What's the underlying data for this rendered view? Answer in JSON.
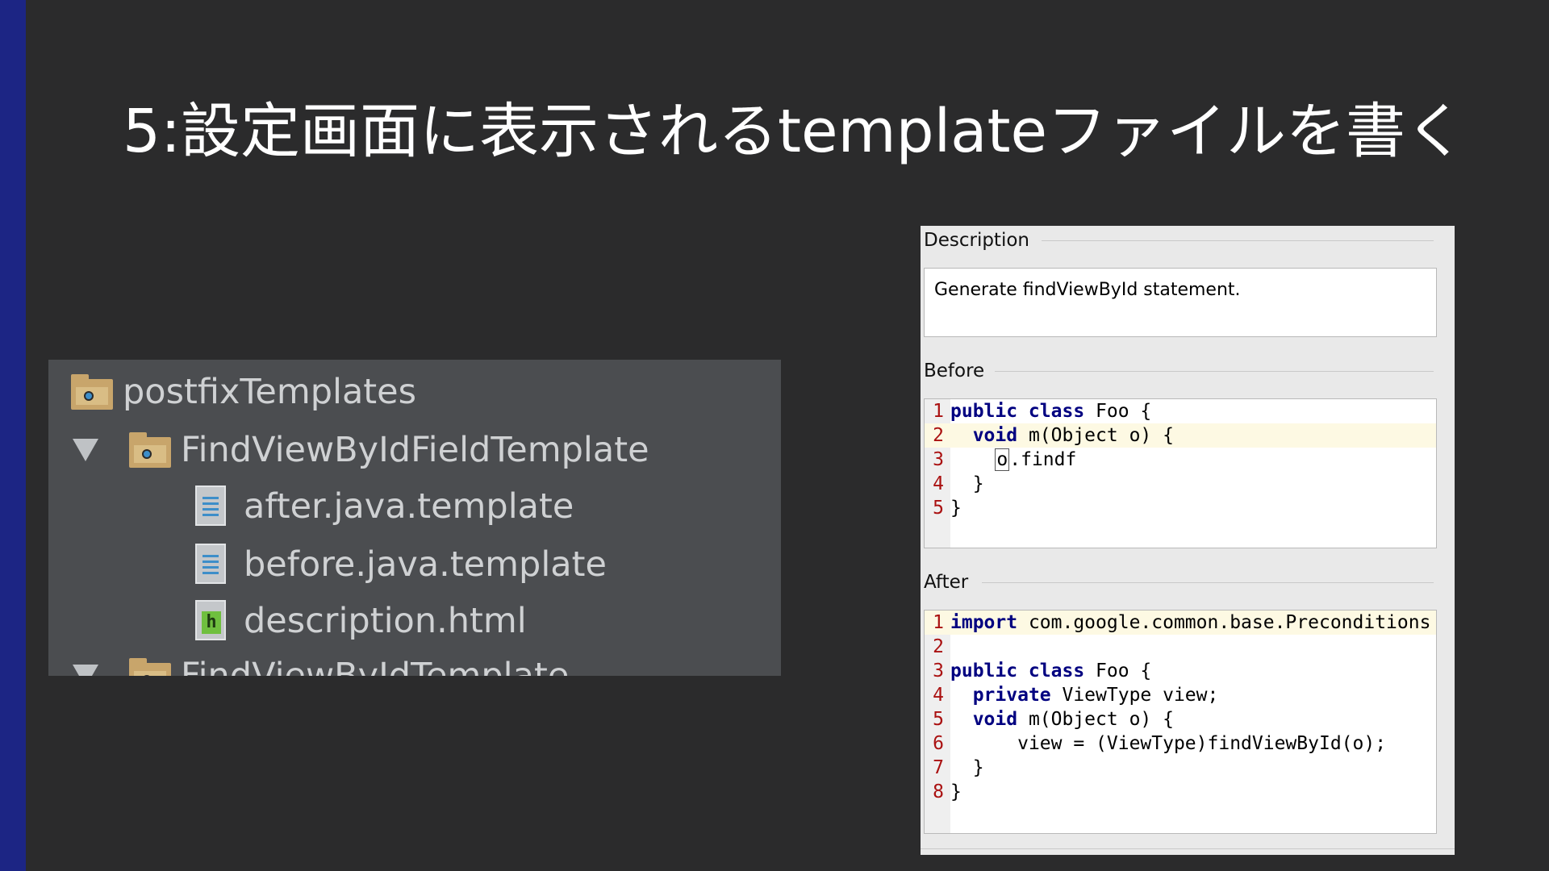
{
  "slide": {
    "title": "5:設定画面に表示されるtemplateファイルを書く"
  },
  "tree": {
    "items": [
      {
        "label": "postfixTemplates",
        "icon": "folder-icon",
        "expanded": false
      },
      {
        "label": "FindViewByIdFieldTemplate",
        "icon": "folder-icon",
        "expanded": true
      },
      {
        "label": "after.java.template",
        "icon": "text-file-icon"
      },
      {
        "label": "before.java.template",
        "icon": "text-file-icon"
      },
      {
        "label": "description.html",
        "icon": "html-file-icon"
      },
      {
        "label": "FindViewByIdTemplate",
        "icon": "folder-icon",
        "expanded": true
      }
    ]
  },
  "panel": {
    "description_label": "Description",
    "description_text": "Generate findViewById statement.",
    "before_label": "Before",
    "after_label": "After",
    "before_code": [
      {
        "n": "1",
        "kw": "public class",
        "rest": " Foo {"
      },
      {
        "n": "2",
        "indent": "  ",
        "kw": "void",
        "rest": " m(Object o) {"
      },
      {
        "n": "3",
        "indent": "    ",
        "caret": "o",
        "rest": ".findf"
      },
      {
        "n": "4",
        "indent": "  ",
        "rest": "}"
      },
      {
        "n": "5",
        "rest": "}"
      }
    ],
    "after_code": [
      {
        "n": "1",
        "kw": "import",
        "rest": " com.google.common.base.Preconditions"
      },
      {
        "n": "2",
        "rest": ""
      },
      {
        "n": "3",
        "kw": "public class",
        "rest": " Foo {"
      },
      {
        "n": "4",
        "indent": "  ",
        "kw": "private",
        "rest": " ViewType view;"
      },
      {
        "n": "5",
        "indent": "  ",
        "kw": "void",
        "rest": " m(Object o) {"
      },
      {
        "n": "6",
        "indent": "      ",
        "rest": "view = (ViewType)findViewById(o);"
      },
      {
        "n": "7",
        "indent": "  ",
        "rest": "}"
      },
      {
        "n": "8",
        "rest": "}"
      }
    ],
    "colors": {
      "keyword": "#000080",
      "line_number": "#aa1111",
      "caret_line": "#fdf9e3"
    }
  }
}
